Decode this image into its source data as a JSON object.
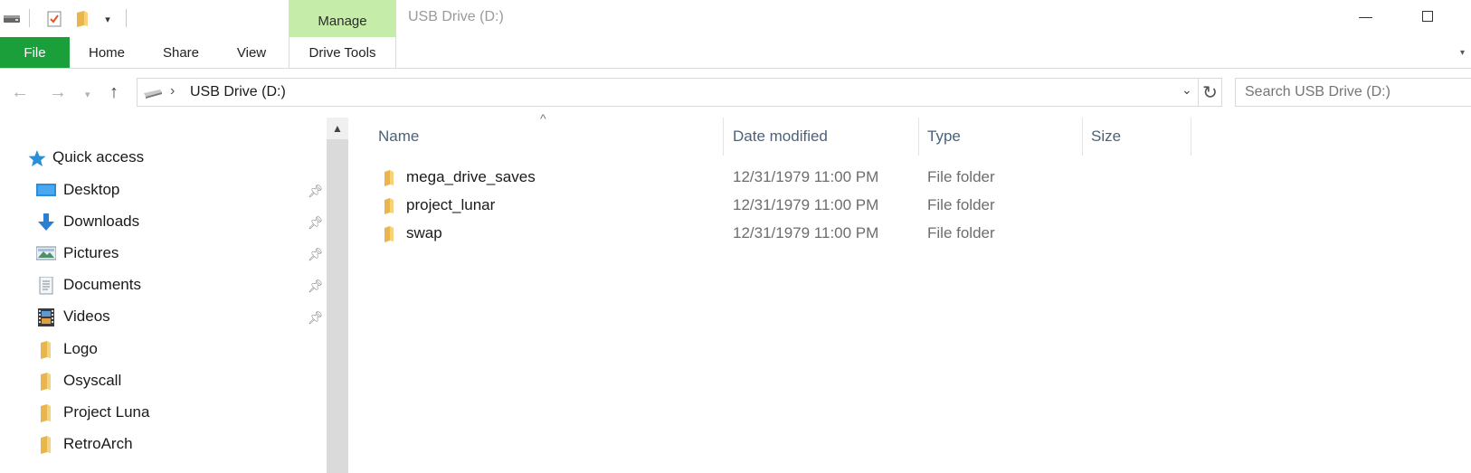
{
  "window": {
    "title": "USB Drive (D:)",
    "manage_tab": "Manage"
  },
  "quick_access_toolbar": {
    "icons": [
      "drive-icon",
      "properties-check-icon",
      "new-folder-icon",
      "customize-dropdown-icon"
    ]
  },
  "ribbon": {
    "tabs": [
      "File",
      "Home",
      "Share",
      "View",
      "Drive Tools"
    ],
    "file_color": "#1b9f3a",
    "manage_color": "#c6ecaa"
  },
  "address_bar": {
    "path": "USB Drive (D:)",
    "search_placeholder": "Search USB Drive (D:)"
  },
  "nav_pane": {
    "quick_access_label": "Quick access",
    "items": [
      {
        "label": "Desktop",
        "icon": "desktop-icon",
        "pinned": true
      },
      {
        "label": "Downloads",
        "icon": "downloads-icon",
        "pinned": true
      },
      {
        "label": "Pictures",
        "icon": "pictures-icon",
        "pinned": true
      },
      {
        "label": "Documents",
        "icon": "documents-icon",
        "pinned": true
      },
      {
        "label": "Videos",
        "icon": "videos-icon",
        "pinned": true
      },
      {
        "label": "Logo",
        "icon": "folder-icon",
        "pinned": false
      },
      {
        "label": "Osyscall",
        "icon": "folder-icon",
        "pinned": false
      },
      {
        "label": "Project Luna",
        "icon": "folder-icon",
        "pinned": false
      },
      {
        "label": "RetroArch",
        "icon": "folder-icon",
        "pinned": false
      }
    ]
  },
  "file_list": {
    "columns": [
      "Name",
      "Date modified",
      "Type",
      "Size"
    ],
    "rows": [
      {
        "name": "mega_drive_saves",
        "date": "12/31/1979 11:00 PM",
        "type": "File folder",
        "size": ""
      },
      {
        "name": "project_lunar",
        "date": "12/31/1979 11:00 PM",
        "type": "File folder",
        "size": ""
      },
      {
        "name": "swap",
        "date": "12/31/1979 11:00 PM",
        "type": "File folder",
        "size": ""
      }
    ]
  }
}
